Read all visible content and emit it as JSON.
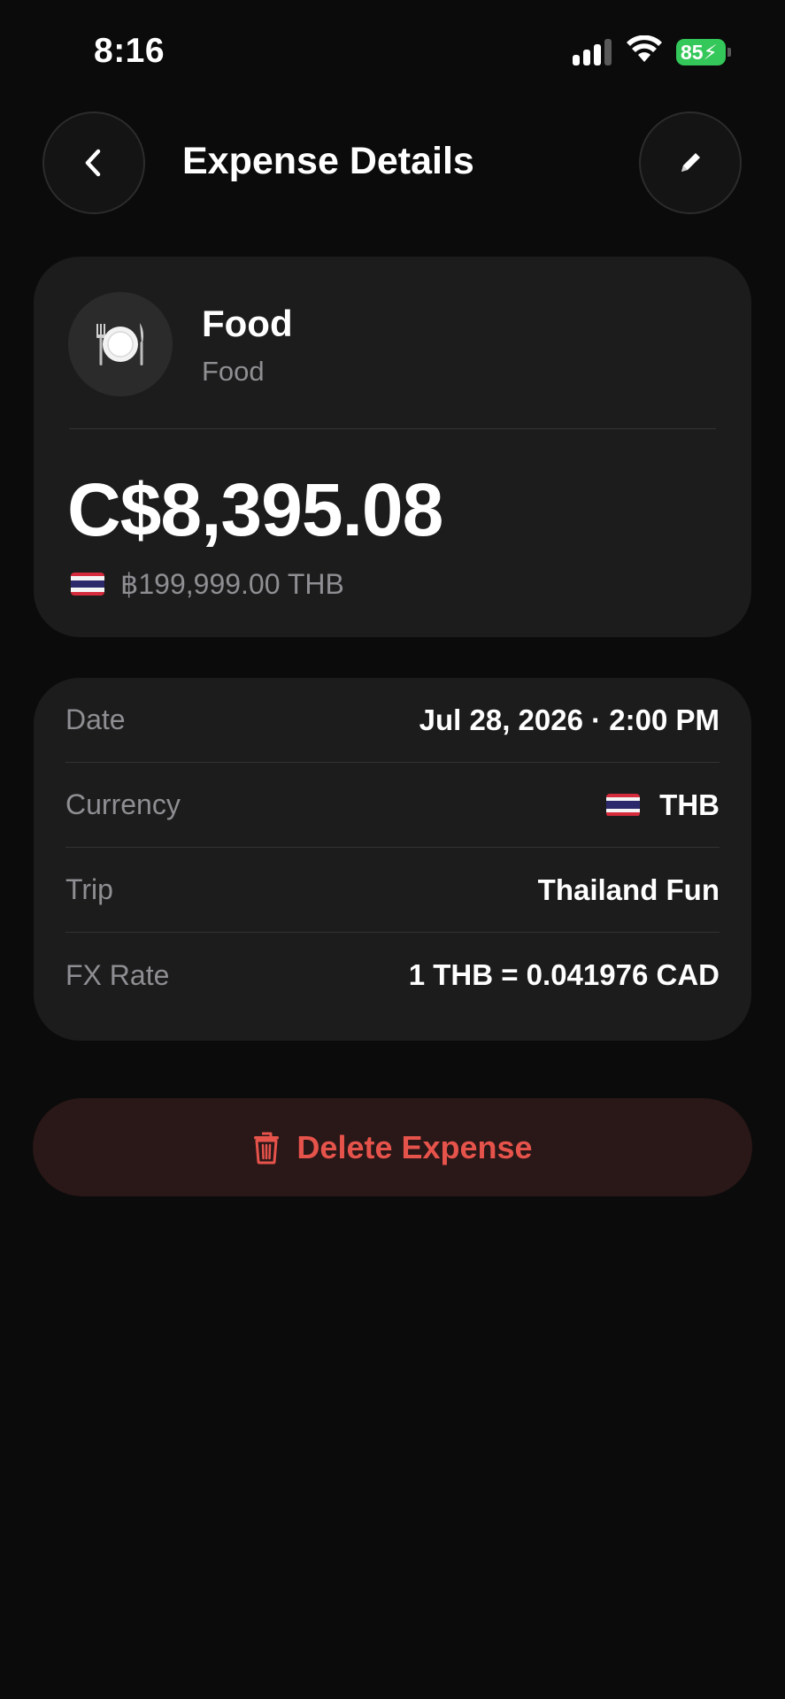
{
  "status_bar": {
    "time": "8:16",
    "battery_level": "85",
    "battery_color": "#34c759"
  },
  "header": {
    "title": "Expense Details",
    "back_icon": "chevron-left-icon",
    "edit_icon": "pencil-icon"
  },
  "summary": {
    "category_name": "Food",
    "category_subtitle": "Food",
    "category_icon": "plate-with-cutlery-icon",
    "converted_amount": "C$8,395.08",
    "original_amount": "฿199,999.00 THB",
    "flag_icon": "thailand-flag-icon"
  },
  "details": {
    "date": {
      "label": "Date",
      "value": "Jul 28, 2026 · 2:00 PM"
    },
    "currency": {
      "label": "Currency",
      "value": "THB"
    },
    "trip": {
      "label": "Trip",
      "value": "Thailand Fun"
    },
    "fx_rate": {
      "label": "FX Rate",
      "value": "1 THB = 0.041976 CAD"
    }
  },
  "actions": {
    "delete_label": "Delete Expense",
    "delete_color": "#e5534b"
  }
}
